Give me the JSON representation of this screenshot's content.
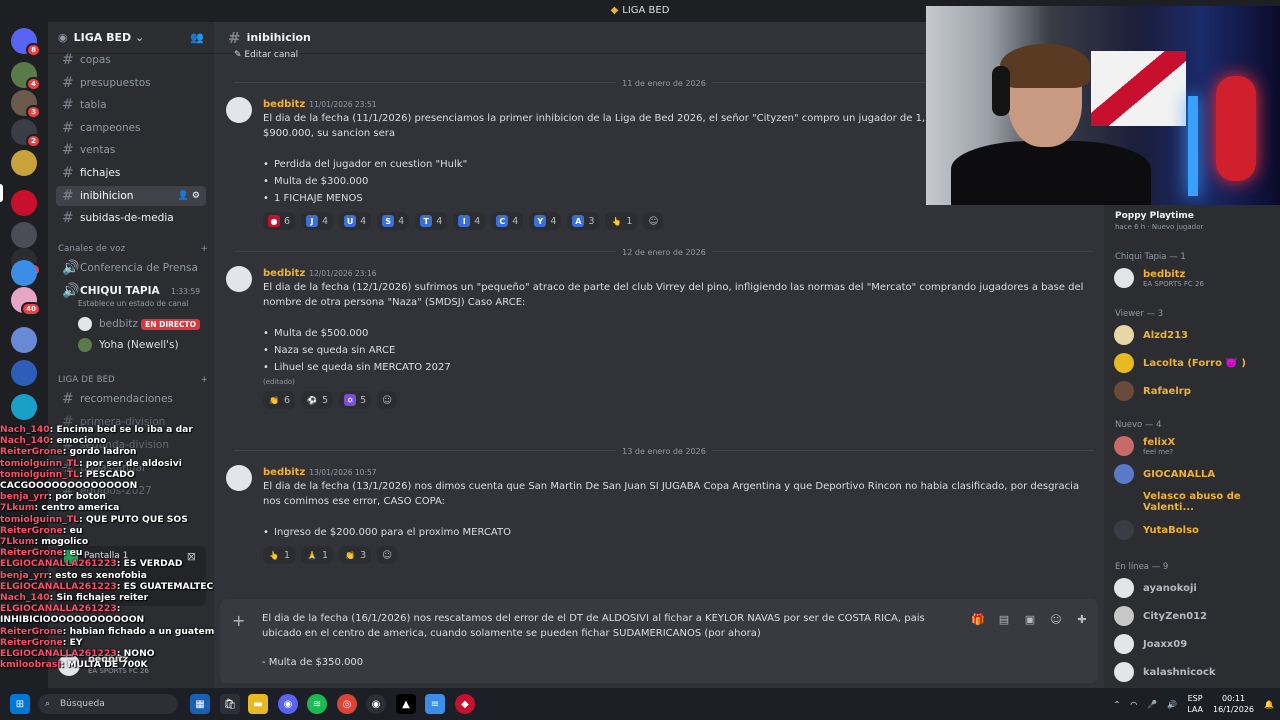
{
  "window": {
    "title": "LIGA BED"
  },
  "servers": [
    {
      "icon": "discord-icon",
      "badge": "8",
      "color": "#5865f2"
    },
    {
      "icon": "server-avatar",
      "badge": "4",
      "color": "#5b7a4a"
    },
    {
      "icon": "server-avatar",
      "badge": "3",
      "color": "#6b5a4a"
    },
    {
      "icon": "server-avatar",
      "badge": "2",
      "color": "#3a3d45"
    },
    {
      "icon": "server-avatar",
      "badge": "",
      "color": "#c8a23a"
    },
    {
      "icon": "server-avatar",
      "badge": "",
      "color": "#c8102e"
    },
    {
      "icon": "server-avatar",
      "badge": "",
      "color": "#4a4d55"
    },
    {
      "icon": "server-avatar",
      "badge": "3",
      "color": "#2b2d31"
    },
    {
      "icon": "server-avatar",
      "badge": "",
      "color": "#3b8de6"
    },
    {
      "icon": "server-avatar",
      "badge": "40",
      "color": "#e6a6c6"
    },
    {
      "icon": "server-avatar",
      "badge": "",
      "color": "#6a8ad6"
    },
    {
      "icon": "server-avatar",
      "badge": "",
      "color": "#2d5db8"
    },
    {
      "icon": "server-avatar",
      "badge": "",
      "color": "#1aa0c8"
    }
  ],
  "sidebar": {
    "guild_name": "LIGA BED",
    "channels": [
      {
        "name": "copas"
      },
      {
        "name": "presupuestos"
      },
      {
        "name": "tabla"
      },
      {
        "name": "campeones"
      },
      {
        "name": "ventas"
      },
      {
        "name": "fichajes"
      },
      {
        "name": "inibihicion"
      },
      {
        "name": "subidas-de-media"
      }
    ],
    "voice_category": "Canales de voz",
    "voice_channels": [
      "Conferencia de Prensa",
      "CHIQUI TAPIA"
    ],
    "voice_timer": "1:33:59",
    "voice_status": "Establece un estado de canal",
    "voice_users": [
      {
        "name": "bedbitz",
        "badge": "EN DIRECTO"
      },
      {
        "name": "Yoha (Newell's)",
        "badge": ""
      }
    ],
    "category2": "LIGA DE BED",
    "category2_channels": [
      "recomendaciones",
      "primera-division",
      "segunda-division",
      "tablas-anual",
      "equipos-2027"
    ],
    "screen_share": "Pantalla 1",
    "self_user": "bedbitz",
    "self_status": "EA SPORTS FC 26"
  },
  "stream_chat": [
    {
      "user": "Nach_140",
      "text": "Encima bed se lo iba a dar"
    },
    {
      "user": "Nach_140",
      "text": "emociono"
    },
    {
      "user": "ReiterGrone",
      "text": "gordo ladron"
    },
    {
      "user": "tomiolguinn_TL",
      "text": "por ser de aldosivi"
    },
    {
      "user": "tomiolguinn_TL",
      "text": "PESCADO CACGOOOOOOOOOOOOON"
    },
    {
      "user": "benja_yrr",
      "text": "por boton"
    },
    {
      "user": "7Lkum",
      "text": "centro america"
    },
    {
      "user": "tomiolguinn_TL",
      "text": "QUE PUTO QUE SOS"
    },
    {
      "user": "ReiterGrone",
      "text": "eu"
    },
    {
      "user": "7Lkum",
      "text": "mogolico"
    },
    {
      "user": "ReiterGrone",
      "text": "eu"
    },
    {
      "user": "ELGIOCANALLA261223",
      "text": "ES VERDAD"
    },
    {
      "user": "benja_yrr",
      "text": "esto es xenofobia"
    },
    {
      "user": "ELGIOCANALLA261223",
      "text": "ES GUATEMALTECO"
    },
    {
      "user": "Nach_140",
      "text": "Sin fichajes reiter"
    },
    {
      "user": "ELGIOCANALLA261223",
      "text": "INHIBICIOOOOOOOOOOOON"
    },
    {
      "user": "ReiterGrone",
      "text": "habian fichado a un guatemaleco"
    },
    {
      "user": "ReiterGrone",
      "text": "EY"
    },
    {
      "user": "ELGIOCANALLA261223",
      "text": "NONO"
    },
    {
      "user": "kmiloobrasi",
      "text": "MULTA DE 700K"
    }
  ],
  "main": {
    "channel_name": "inibihicion",
    "edit_channel": "Editar canal",
    "messages": [
      {
        "date": "11 de enero de 2026",
        "author": "bedbitz",
        "time": "11/01/2026 23:51",
        "text": "El dia de la fecha (11/1/2026) presenciamos la primer inhibicion de la Liga de Bed 2026, el señor \"Cityzen\" compro un jugador de 1,2M teniendo de presupuesto $900.000, su sancion sera",
        "bullets": [
          "Perdida del jugador en cuestion \"Hulk\"",
          "Multa de $300.000",
          "1 FICHAJE MENOS"
        ],
        "edited": "",
        "reactions": [
          {
            "e": "●",
            "c": "#c8102e",
            "n": "6"
          },
          {
            "e": "J",
            "c": "#3b6fd6",
            "n": "4"
          },
          {
            "e": "U",
            "c": "#3b6fd6",
            "n": "4"
          },
          {
            "e": "S",
            "c": "#3b6fd6",
            "n": "4"
          },
          {
            "e": "T",
            "c": "#3b6fd6",
            "n": "4"
          },
          {
            "e": "I",
            "c": "#3b6fd6",
            "n": "4"
          },
          {
            "e": "C",
            "c": "#3b6fd6",
            "n": "4"
          },
          {
            "e": "Y",
            "c": "#3b6fd6",
            "n": "4"
          },
          {
            "e": "A",
            "c": "#3b6fd6",
            "n": "3"
          },
          {
            "e": "👆",
            "c": "#2b2d31",
            "n": "1"
          }
        ]
      },
      {
        "date": "12 de enero de 2026",
        "author": "bedbitz",
        "time": "12/01/2026 23:16",
        "text": "El dia de la fecha (12/1/2026) sufrimos un \"pequeño\" atraco de parte del club Virrey del pino, infligiendo las normas del \"Mercato\" comprando jugadores a base del nombre de otra persona \"Naza\" (SMDSJ) Caso ARCE:",
        "bullets": [
          "Multa de $500.000",
          "Naza se queda sin ARCE",
          "Lihuel se queda sin MERCATO 2027"
        ],
        "edited": "(editado)",
        "reactions": [
          {
            "e": "👏",
            "c": "#2b2d31",
            "n": "6"
          },
          {
            "e": "⚽",
            "c": "#2b2d31",
            "n": "5"
          },
          {
            "e": "✡",
            "c": "#7a4fd6",
            "n": "5"
          }
        ]
      },
      {
        "date": "13 de enero de 2026",
        "author": "bedbitz",
        "time": "13/01/2026 10:57",
        "text": "El dia de la fecha (13/1/2026) nos dimos cuenta que San Martin De San Juan SI JUGABA Copa Argentina y que Deportivo Rincon no habia clasificado, por desgracia nos comimos ese error, CASO COPA:",
        "bullets": [
          "Ingreso de $200.000 para el proximo MERCATO"
        ],
        "edited": "",
        "reactions": [
          {
            "e": "👆",
            "c": "#2b2d31",
            "n": "1"
          },
          {
            "e": "🙏",
            "c": "#2b2d31",
            "n": "1"
          },
          {
            "e": "👏",
            "c": "#2b2d31",
            "n": "3"
          }
        ]
      }
    ],
    "composer_text": "El dia de la fecha (16/1/2026) nos rescatamos del error de el DT de ALDOSIVI al fichar a  KEYLOR NAVAS por ser de COSTA RICA, pais ubicado en el centro de america, cuando solamente se pueden fichar SUDAMERICANOS (por ahora)",
    "composer_text2": "- Multa de $350.000"
  },
  "members": {
    "activity": {
      "name": "Poppy Playtime",
      "sub": "hace 6 h",
      "sub2": "Nuevo jugador"
    },
    "groups": [
      {
        "title": "Chiqui Tapia — 1",
        "people": [
          {
            "name": "bedbitz",
            "status": "EA SPORTS FC 26",
            "color": "#f0b232"
          }
        ]
      },
      {
        "title": "Viewer — 3",
        "people": [
          {
            "name": "Alzd213",
            "status": "",
            "color": "#f0b232"
          },
          {
            "name": "Lacolta (Forro 👿 )",
            "status": "",
            "color": "#f0b232"
          },
          {
            "name": "Rafaelrp",
            "status": "",
            "color": "#f0b232"
          }
        ]
      },
      {
        "title": "Nuevo — 4",
        "people": [
          {
            "name": "felixX",
            "status": "feel me?",
            "color": "#f0b232"
          },
          {
            "name": "GIOCANALLA",
            "status": "",
            "color": "#f0b232"
          },
          {
            "name": "Velasco abuso de Valenti...",
            "status": "",
            "color": "#f0b232"
          },
          {
            "name": "YutaBolso",
            "status": "",
            "color": "#f0b232"
          }
        ]
      },
      {
        "title": "En línea — 9",
        "people": [
          {
            "name": "ayanokoji",
            "status": "",
            "color": "#b5bac1"
          },
          {
            "name": "CityZen012",
            "status": "",
            "color": "#b5bac1"
          },
          {
            "name": "Joaxx09",
            "status": "",
            "color": "#b5bac1"
          },
          {
            "name": "kalashnicock",
            "status": "",
            "color": "#b5bac1"
          }
        ]
      }
    ]
  },
  "taskbar": {
    "search_placeholder": "Búsqueda",
    "lang": "ESP",
    "lang2": "LAA",
    "time": "00:11",
    "date": "16/1/2026"
  }
}
